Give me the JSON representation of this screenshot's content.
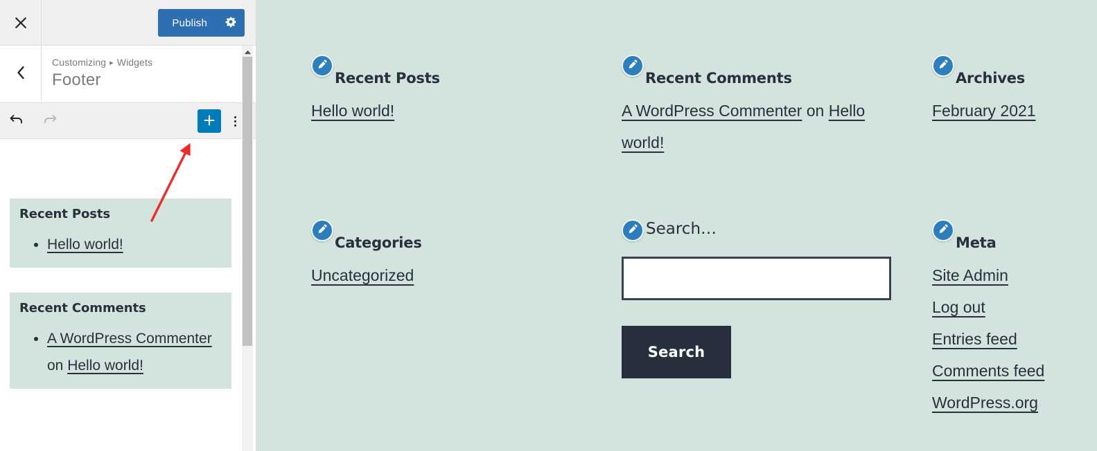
{
  "customizer": {
    "close_label": "Close customizer",
    "publish_label": "Publish",
    "publish_color": "#2d6fb0",
    "settings_icon": "gear-icon",
    "breadcrumb": {
      "root": "Customizing",
      "separator": "▸",
      "section": "Widgets"
    },
    "panel_title": "Footer",
    "back_label": "Back",
    "toolbar": {
      "undo_label": "Undo",
      "redo_label": "Redo",
      "add_block_label": "+",
      "add_block_color": "#007cba",
      "more_options_label": "Options"
    },
    "widgets": [
      {
        "title": "Recent Posts",
        "items": [
          {
            "parts": [
              {
                "text": "Hello world!",
                "link": true
              }
            ]
          }
        ]
      },
      {
        "title": "Recent Comments",
        "items": [
          {
            "parts": [
              {
                "text": "A WordPress Commenter",
                "link": true
              },
              {
                "text": " on ",
                "link": false
              },
              {
                "text": "Hello world!",
                "link": true
              }
            ]
          }
        ]
      }
    ]
  },
  "annotation": {
    "type": "arrow",
    "color": "#ee2b2b",
    "points_to": "add-block-button"
  },
  "preview": {
    "background_color": "#d2e4dd",
    "edit_icon": "pencil-icon",
    "widgets": [
      {
        "id": "recent-posts",
        "title": "Recent Posts",
        "links": [
          "Hello world!"
        ]
      },
      {
        "id": "recent-comments",
        "title": "Recent Comments",
        "comment": {
          "author": "A WordPress Commenter",
          "connector": " on ",
          "post": "Hello world!"
        }
      },
      {
        "id": "archives",
        "title": "Archives",
        "links": [
          "February 2021"
        ]
      },
      {
        "id": "categories",
        "title": "Categories",
        "links": [
          "Uncategorized"
        ]
      },
      {
        "id": "search",
        "title": "Search…",
        "input_value": "",
        "input_placeholder": "",
        "submit_label": "Search",
        "submit_color": "#28303d"
      },
      {
        "id": "meta",
        "title": "Meta",
        "links": [
          "Site Admin",
          "Log out",
          "Entries feed",
          "Comments feed",
          "WordPress.org"
        ]
      }
    ]
  }
}
